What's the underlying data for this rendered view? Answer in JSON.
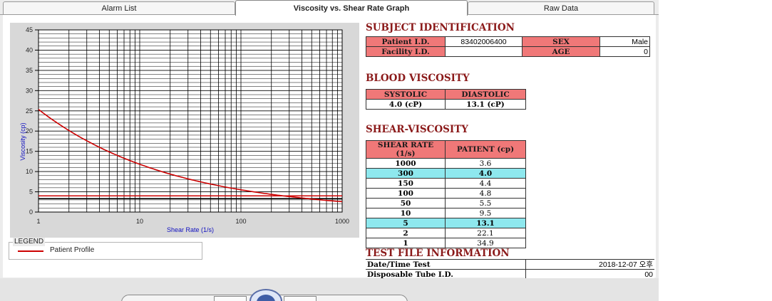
{
  "tabs": [
    {
      "label": "Alarm List"
    },
    {
      "label": "Viscosity vs. Shear Rate Graph",
      "active": true
    },
    {
      "label": "Raw Data"
    }
  ],
  "chart_data": {
    "type": "line",
    "xlabel": "Shear Rate (1/s)",
    "ylabel": "Viscosity (cp)",
    "xscale": "log",
    "xlim": [
      1,
      1000
    ],
    "ylim": [
      0,
      45
    ],
    "xticks": [
      "1",
      "10",
      "100",
      "1000"
    ],
    "yticks": [
      "0",
      "5",
      "10",
      "15",
      "20",
      "25",
      "30",
      "35",
      "40",
      "45"
    ],
    "grid": true,
    "legend_position": "below",
    "series": [
      {
        "name": "Patient Profile",
        "color": "#cc0000",
        "x": [
          1,
          2,
          5,
          10,
          50,
          100,
          150,
          300,
          1000
        ],
        "y": [
          34.9,
          22.1,
          13.1,
          9.5,
          5.5,
          4.8,
          4.4,
          4.0,
          3.6
        ]
      }
    ],
    "reference_lines": [
      {
        "y": 3.3,
        "color": "#000000"
      },
      {
        "y": 4.0,
        "color": "#cc0000"
      }
    ]
  },
  "legend": {
    "title": "LEGEND",
    "items": [
      {
        "label": "Patient Profile",
        "color": "#cc0000"
      }
    ]
  },
  "subject": {
    "title": "SUBJECT IDENTIFICATION",
    "patient_id_label": "Patient I.D.",
    "patient_id_value": "83402006400",
    "sex_label": "SEX",
    "sex_value": "Male",
    "facility_id_label": "Facility I.D.",
    "facility_id_value": "",
    "age_label": "AGE",
    "age_value": "0"
  },
  "blood": {
    "title": "BLOOD VISCOSITY",
    "systolic_label": "SYSTOLIC",
    "diastolic_label": "DIASTOLIC",
    "systolic_value": "4.0 (cP)",
    "diastolic_value": "13.1 (cP)"
  },
  "shear": {
    "title": "SHEAR-VISCOSITY",
    "col1": "SHEAR RATE (1/s)",
    "col2": "PATIENT (cp)",
    "rows": [
      {
        "rate": "1000",
        "value": "3.6"
      },
      {
        "rate": "300",
        "value": "4.0",
        "highlight": true
      },
      {
        "rate": "150",
        "value": "4.4"
      },
      {
        "rate": "100",
        "value": "4.8"
      },
      {
        "rate": "50",
        "value": "5.5"
      },
      {
        "rate": "10",
        "value": "9.5"
      },
      {
        "rate": "5",
        "value": "13.1",
        "highlight": true
      },
      {
        "rate": "2",
        "value": "22.1"
      },
      {
        "rate": "1",
        "value": "34.9"
      }
    ]
  },
  "test_file": {
    "title": "TEST FILE INFORMATION",
    "date_label": "Date/Time Test",
    "date_value": "2018-12-07  오후",
    "tube_label": "Disposable Tube I.D.",
    "tube_value": "00"
  },
  "colors": {
    "header_fill": "#f07878",
    "highlight_fill": "#8ee8ee",
    "section_title": "#8b1a1a",
    "curve": "#cc0000"
  }
}
